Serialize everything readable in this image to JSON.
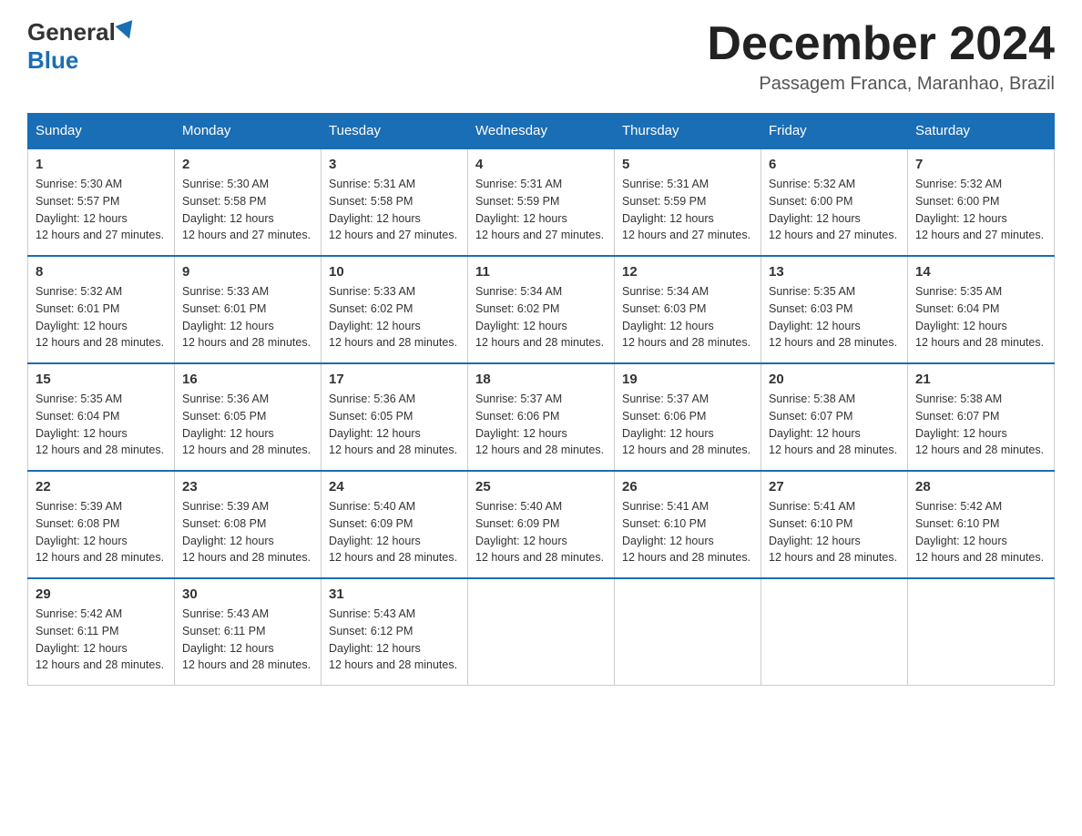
{
  "header": {
    "logo_general": "General",
    "logo_blue": "Blue",
    "month_title": "December 2024",
    "location": "Passagem Franca, Maranhao, Brazil"
  },
  "days_of_week": [
    "Sunday",
    "Monday",
    "Tuesday",
    "Wednesday",
    "Thursday",
    "Friday",
    "Saturday"
  ],
  "weeks": [
    [
      {
        "day": "1",
        "sunrise": "5:30 AM",
        "sunset": "5:57 PM",
        "daylight": "12 hours and 27 minutes."
      },
      {
        "day": "2",
        "sunrise": "5:30 AM",
        "sunset": "5:58 PM",
        "daylight": "12 hours and 27 minutes."
      },
      {
        "day": "3",
        "sunrise": "5:31 AM",
        "sunset": "5:58 PM",
        "daylight": "12 hours and 27 minutes."
      },
      {
        "day": "4",
        "sunrise": "5:31 AM",
        "sunset": "5:59 PM",
        "daylight": "12 hours and 27 minutes."
      },
      {
        "day": "5",
        "sunrise": "5:31 AM",
        "sunset": "5:59 PM",
        "daylight": "12 hours and 27 minutes."
      },
      {
        "day": "6",
        "sunrise": "5:32 AM",
        "sunset": "6:00 PM",
        "daylight": "12 hours and 27 minutes."
      },
      {
        "day": "7",
        "sunrise": "5:32 AM",
        "sunset": "6:00 PM",
        "daylight": "12 hours and 27 minutes."
      }
    ],
    [
      {
        "day": "8",
        "sunrise": "5:32 AM",
        "sunset": "6:01 PM",
        "daylight": "12 hours and 28 minutes."
      },
      {
        "day": "9",
        "sunrise": "5:33 AM",
        "sunset": "6:01 PM",
        "daylight": "12 hours and 28 minutes."
      },
      {
        "day": "10",
        "sunrise": "5:33 AM",
        "sunset": "6:02 PM",
        "daylight": "12 hours and 28 minutes."
      },
      {
        "day": "11",
        "sunrise": "5:34 AM",
        "sunset": "6:02 PM",
        "daylight": "12 hours and 28 minutes."
      },
      {
        "day": "12",
        "sunrise": "5:34 AM",
        "sunset": "6:03 PM",
        "daylight": "12 hours and 28 minutes."
      },
      {
        "day": "13",
        "sunrise": "5:35 AM",
        "sunset": "6:03 PM",
        "daylight": "12 hours and 28 minutes."
      },
      {
        "day": "14",
        "sunrise": "5:35 AM",
        "sunset": "6:04 PM",
        "daylight": "12 hours and 28 minutes."
      }
    ],
    [
      {
        "day": "15",
        "sunrise": "5:35 AM",
        "sunset": "6:04 PM",
        "daylight": "12 hours and 28 minutes."
      },
      {
        "day": "16",
        "sunrise": "5:36 AM",
        "sunset": "6:05 PM",
        "daylight": "12 hours and 28 minutes."
      },
      {
        "day": "17",
        "sunrise": "5:36 AM",
        "sunset": "6:05 PM",
        "daylight": "12 hours and 28 minutes."
      },
      {
        "day": "18",
        "sunrise": "5:37 AM",
        "sunset": "6:06 PM",
        "daylight": "12 hours and 28 minutes."
      },
      {
        "day": "19",
        "sunrise": "5:37 AM",
        "sunset": "6:06 PM",
        "daylight": "12 hours and 28 minutes."
      },
      {
        "day": "20",
        "sunrise": "5:38 AM",
        "sunset": "6:07 PM",
        "daylight": "12 hours and 28 minutes."
      },
      {
        "day": "21",
        "sunrise": "5:38 AM",
        "sunset": "6:07 PM",
        "daylight": "12 hours and 28 minutes."
      }
    ],
    [
      {
        "day": "22",
        "sunrise": "5:39 AM",
        "sunset": "6:08 PM",
        "daylight": "12 hours and 28 minutes."
      },
      {
        "day": "23",
        "sunrise": "5:39 AM",
        "sunset": "6:08 PM",
        "daylight": "12 hours and 28 minutes."
      },
      {
        "day": "24",
        "sunrise": "5:40 AM",
        "sunset": "6:09 PM",
        "daylight": "12 hours and 28 minutes."
      },
      {
        "day": "25",
        "sunrise": "5:40 AM",
        "sunset": "6:09 PM",
        "daylight": "12 hours and 28 minutes."
      },
      {
        "day": "26",
        "sunrise": "5:41 AM",
        "sunset": "6:10 PM",
        "daylight": "12 hours and 28 minutes."
      },
      {
        "day": "27",
        "sunrise": "5:41 AM",
        "sunset": "6:10 PM",
        "daylight": "12 hours and 28 minutes."
      },
      {
        "day": "28",
        "sunrise": "5:42 AM",
        "sunset": "6:10 PM",
        "daylight": "12 hours and 28 minutes."
      }
    ],
    [
      {
        "day": "29",
        "sunrise": "5:42 AM",
        "sunset": "6:11 PM",
        "daylight": "12 hours and 28 minutes."
      },
      {
        "day": "30",
        "sunrise": "5:43 AM",
        "sunset": "6:11 PM",
        "daylight": "12 hours and 28 minutes."
      },
      {
        "day": "31",
        "sunrise": "5:43 AM",
        "sunset": "6:12 PM",
        "daylight": "12 hours and 28 minutes."
      },
      null,
      null,
      null,
      null
    ]
  ]
}
